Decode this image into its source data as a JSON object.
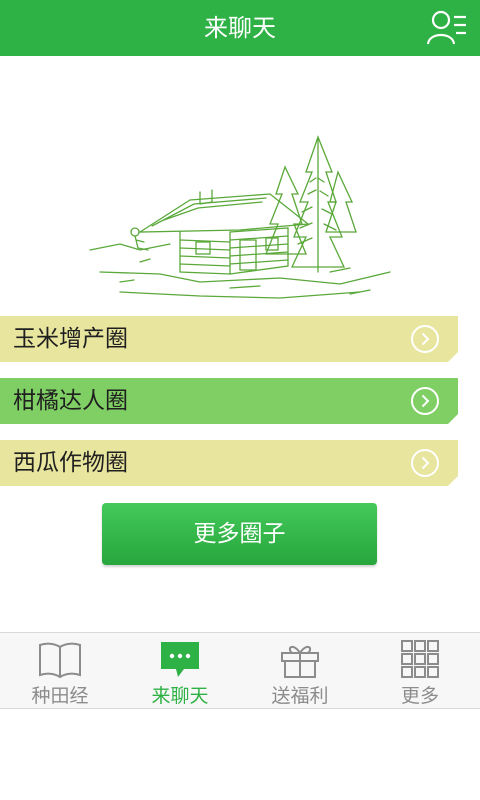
{
  "header": {
    "title": "来聊天"
  },
  "circles": [
    {
      "label": "玉米增产圈",
      "color": "#e8e59f"
    },
    {
      "label": "柑橘达人圈",
      "color": "#7fcf64"
    },
    {
      "label": "西瓜作物圈",
      "color": "#e8e59f"
    }
  ],
  "more_button": {
    "label": "更多圈子"
  },
  "tabs": [
    {
      "label": "种田经",
      "icon": "book-icon",
      "active": false
    },
    {
      "label": "来聊天",
      "icon": "chat-icon",
      "active": true
    },
    {
      "label": "送福利",
      "icon": "gift-icon",
      "active": false
    },
    {
      "label": "更多",
      "icon": "grid-icon",
      "active": false
    }
  ],
  "colors": {
    "brand": "#2fb245",
    "inactive": "#8c8c8c"
  }
}
